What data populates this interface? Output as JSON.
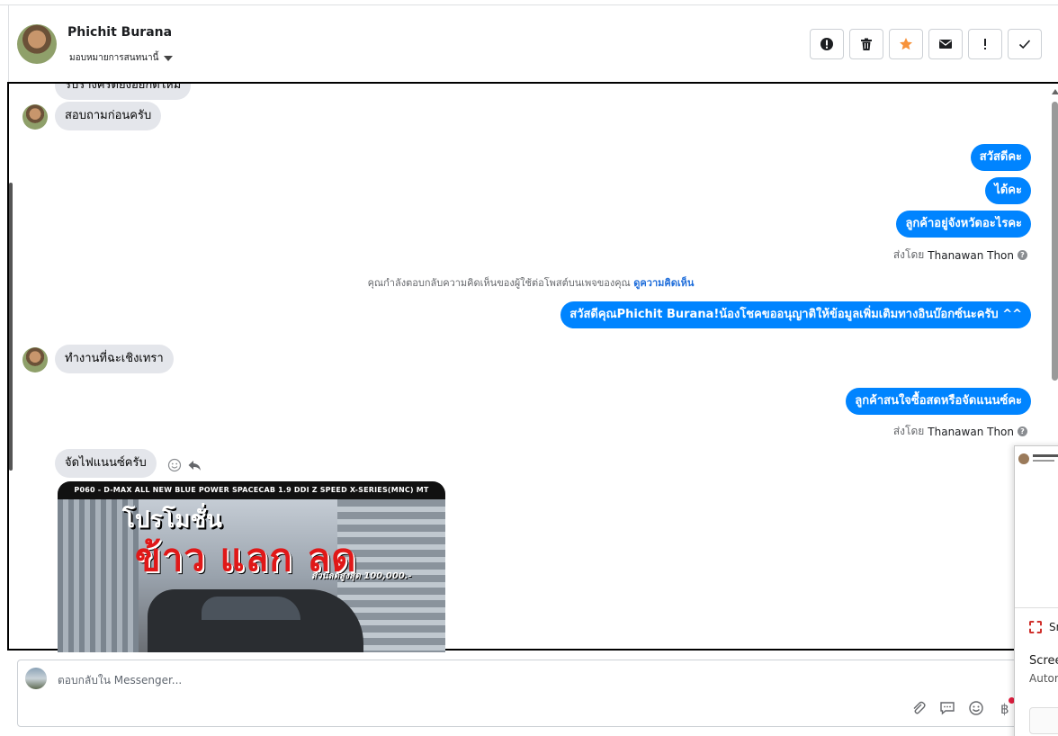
{
  "header": {
    "name": "Phichit Burana",
    "assign_label": "มอบหมายการสนทนานี้"
  },
  "actions": [
    {
      "icon": "alert-circle-icon"
    },
    {
      "icon": "trash-icon"
    },
    {
      "icon": "star-icon",
      "color": "#f7923a"
    },
    {
      "icon": "envelope-icon"
    },
    {
      "icon": "exclamation-icon"
    },
    {
      "icon": "check-icon"
    }
  ],
  "messages": {
    "cut_top": "รับรางครดยงอยกดใหม",
    "in_1": "สอบถามก่อนครับ",
    "out_1": "สวัสดีคะ",
    "out_2": "ได้คะ",
    "out_3": "ลูกค้าอยู่จังหวัดอะไรคะ",
    "sent_by_prefix": "ส่งโดย",
    "sent_by_name_1": "Thanawan Thon",
    "system_note": "คุณกำลังตอบกลับความคิดเห็นของผู้ใช้ต่อโพสต์บนเพจของคุณ",
    "system_link": "ดูความคิดเห็น",
    "out_4": "สวัสดีคุณPhichit Burana!น้องโชคขออนุญาติให้ข้อมูลเพิ่มเติมทางอินบ๊อกซ์นะครับ ^^",
    "in_2": "ทำงานที่ฉะเชิงเทรา",
    "out_5": "ลูกค้าสนใจซื้อสดหรือจัดแนนซ์คะ",
    "sent_by_name_2": "Thanawan Thon",
    "in_3": "จัดไฟแนนซ์ครับ"
  },
  "promo": {
    "top_bar": "P060 - D-MAX ALL NEW BLUE POWER SPACECAB 1.9 DDI Z SPEED X-SERIES(MNC) MT",
    "title_1": "โปรโมชั่น",
    "title_2": "ข้าว แลก ลด",
    "discount": "ส่วนลดสูงสุด 100,000.-"
  },
  "composer": {
    "placeholder": "ตอบกลับใน Messenger..."
  },
  "popup": {
    "app_name": "Sn",
    "title": "Scree",
    "subtitle": "Autor"
  }
}
